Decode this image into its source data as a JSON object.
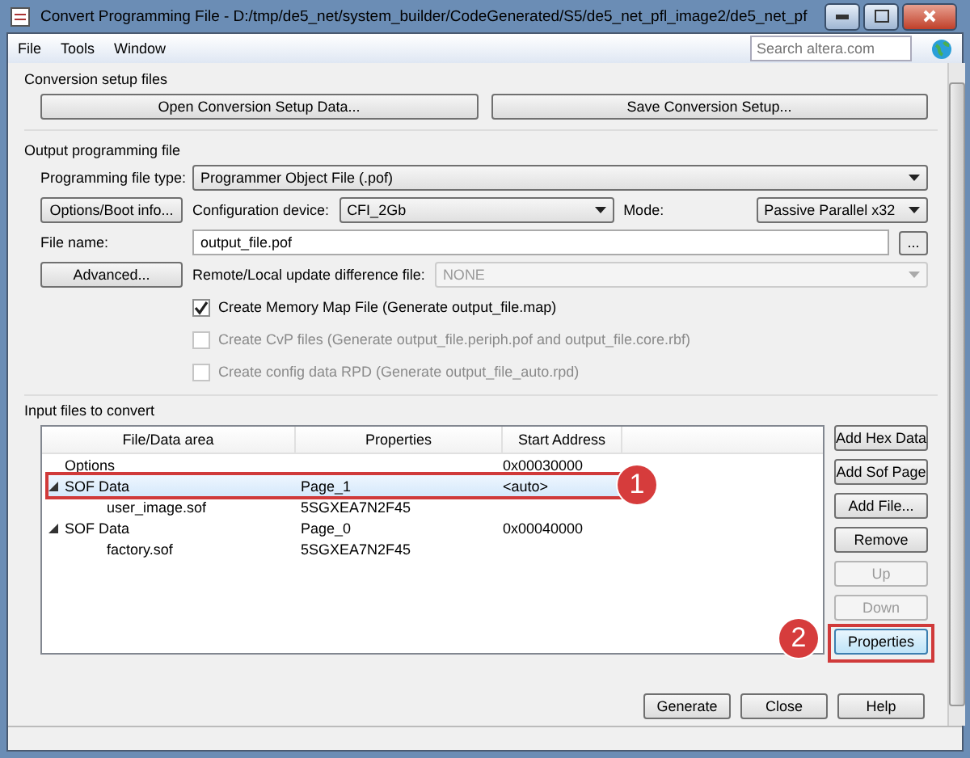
{
  "window": {
    "title": "Convert Programming File - D:/tmp/de5_net/system_builder/CodeGenerated/S5/de5_net_pfl_image2/de5_net_pf"
  },
  "menu": [
    "File",
    "Tools",
    "Window"
  ],
  "search": {
    "placeholder": "Search altera.com"
  },
  "conversion_setup": {
    "title": "Conversion setup files",
    "buttons": [
      "Open Conversion Setup Data...",
      "Save Conversion Setup..."
    ]
  },
  "output": {
    "title": "Output programming file",
    "file_type": {
      "label": "Programming file type:",
      "value": "Programmer Object File (.pof)"
    },
    "options_button": "Options/Boot info...",
    "config_device": {
      "label": "Configuration device:",
      "value": "CFI_2Gb"
    },
    "mode": {
      "label": "Mode:",
      "value": "Passive Parallel x32"
    },
    "file_name": {
      "label": "File name:",
      "value": "output_file.pof",
      "browse": "..."
    },
    "advanced_button": "Advanced...",
    "difference_file": {
      "label": "Remote/Local update difference file:",
      "value": "NONE",
      "disabled": true
    },
    "checkboxes": [
      {
        "label": "Create Memory Map File (Generate output_file.map)",
        "checked": true,
        "disabled": false
      },
      {
        "label": "Create CvP files (Generate output_file.periph.pof and output_file.core.rbf)",
        "checked": false,
        "disabled": true
      },
      {
        "label": "Create config data RPD (Generate output_file_auto.rpd)",
        "checked": false,
        "disabled": true
      }
    ]
  },
  "input": {
    "title": "Input files to convert",
    "columns": [
      "File/Data area",
      "Properties",
      "Start Address"
    ],
    "rows": [
      {
        "name": "Options",
        "address": "0x00030000",
        "selected": false
      },
      {
        "name": "SOF Data",
        "properties": "Page_1",
        "address": "<auto>",
        "expanded": true,
        "selected": true,
        "callout": "1",
        "children": [
          {
            "name": "user_image.sof",
            "properties": "5SGXEA7N2F45",
            "selected": false
          }
        ]
      },
      {
        "name": "SOF Data",
        "properties": "Page_0",
        "address": "0x00040000",
        "expanded": true,
        "selected": false,
        "children": [
          {
            "name": "factory.sof",
            "properties": "5SGXEA7N2F45",
            "selected": false
          }
        ]
      }
    ],
    "side_buttons": [
      {
        "label": "Add Hex Data",
        "disabled": false,
        "focused": false
      },
      {
        "label": "Add Sof Page",
        "disabled": false,
        "focused": false
      },
      {
        "label": "Add File...",
        "disabled": false,
        "focused": false
      },
      {
        "label": "Remove",
        "disabled": false,
        "focused": false
      },
      {
        "label": "Up",
        "disabled": true,
        "focused": false
      },
      {
        "label": "Down",
        "disabled": true,
        "focused": false
      },
      {
        "label": "Properties",
        "disabled": false,
        "focused": true,
        "callout": "2"
      }
    ]
  },
  "footer_buttons": [
    "Generate",
    "Close",
    "Help"
  ]
}
